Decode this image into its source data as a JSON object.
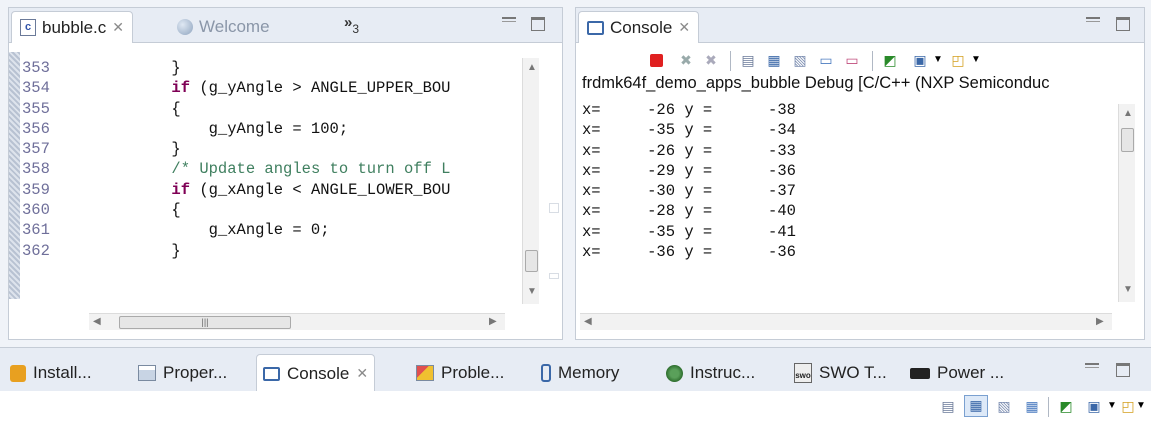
{
  "editor": {
    "tabs": [
      {
        "label": "bubble.c",
        "active": true
      },
      {
        "label": "Welcome",
        "active": false
      }
    ],
    "overflow_count": "3",
    "line_numbers": [
      "353",
      "354",
      "355",
      "356",
      "357",
      "358",
      "359",
      "360",
      "361",
      "362"
    ],
    "code_lines": [
      {
        "pre": "        }",
        "kw": "",
        "post": "",
        "comment": ""
      },
      {
        "pre": "        ",
        "kw": "if",
        "post": " (g_yAngle > ANGLE_UPPER_BOU",
        "comment": ""
      },
      {
        "pre": "        {",
        "kw": "",
        "post": "",
        "comment": ""
      },
      {
        "pre": "            g_yAngle = 100;",
        "kw": "",
        "post": "",
        "comment": ""
      },
      {
        "pre": "        }",
        "kw": "",
        "post": "",
        "comment": ""
      },
      {
        "pre": "        ",
        "kw": "",
        "post": "",
        "comment": "/* Update angles to turn off L"
      },
      {
        "pre": "        ",
        "kw": "if",
        "post": " (g_xAngle < ANGLE_LOWER_BOU",
        "comment": ""
      },
      {
        "pre": "        {",
        "kw": "",
        "post": "",
        "comment": ""
      },
      {
        "pre": "            g_xAngle = 0;",
        "kw": "",
        "post": "",
        "comment": ""
      },
      {
        "pre": "        }",
        "kw": "",
        "post": "",
        "comment": ""
      }
    ]
  },
  "console": {
    "tab_label": "Console",
    "title": "frdmk64f_demo_apps_bubble Debug [C/C++ (NXP Semiconduc",
    "lines": [
      "x=     -26 y =      -38",
      "x=     -35 y =      -34",
      "x=     -26 y =      -33",
      "x=     -29 y =      -36",
      "x=     -30 y =      -37",
      "x=     -28 y =      -40",
      "x=     -35 y =      -41",
      "x=     -36 y =      -36"
    ]
  },
  "bottom_tabs": [
    {
      "label": "Install...",
      "icon": "install-icon"
    },
    {
      "label": "Proper...",
      "icon": "properties-icon"
    },
    {
      "label": "Console",
      "icon": "console-icon",
      "active": true
    },
    {
      "label": "Proble...",
      "icon": "problems-icon"
    },
    {
      "label": "Memory",
      "icon": "memory-icon"
    },
    {
      "label": "Instruc...",
      "icon": "instruction-icon"
    },
    {
      "label": "SWO T...",
      "icon": "swo-icon"
    },
    {
      "label": "Power ...",
      "icon": "power-icon"
    }
  ],
  "colors": {
    "keyword": "#7f0055",
    "comment": "#3f7f5f",
    "line_number": "#6f6f9a",
    "terminate_red": "#e02020"
  }
}
